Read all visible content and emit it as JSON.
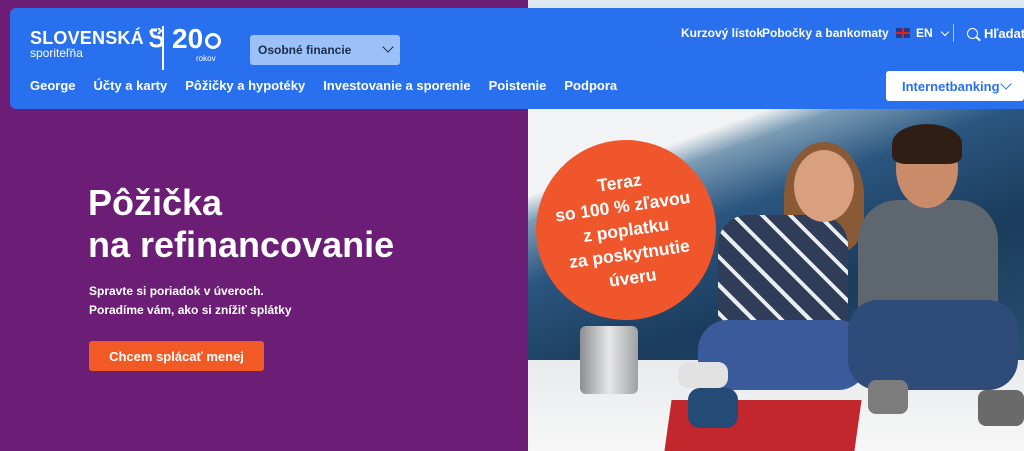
{
  "header": {
    "logo": {
      "main": "SLOVENSKÁ",
      "sub": "sporiteľňa"
    },
    "anniversary": {
      "number": "20",
      "sub": "rokov"
    },
    "segment": {
      "selected": "Osobné financie"
    },
    "utility": {
      "rate_list": "Kurzový lístok",
      "branches": "Pobočky a bankomaty",
      "language": "EN",
      "search": "Hľadať"
    },
    "nav": [
      "George",
      "Účty a karty",
      "Pôžičky a hypotéky",
      "Investovanie a sporenie",
      "Poistenie",
      "Podpora"
    ],
    "internetbanking": "Internetbanking"
  },
  "hero": {
    "title_line1": "Pôžička",
    "title_line2": "na refinancovanie",
    "subtitle_line1": "Spravte si poriadok v úveroch.",
    "subtitle_line2": "Poradíme vám, ako si znížiť splátky",
    "cta": "Chcem splácať menej"
  },
  "badge": {
    "lines": [
      "Teraz",
      "so 100 % zľavou",
      "z poplatku",
      "za poskytnutie",
      "úveru"
    ]
  },
  "colors": {
    "brand_blue": "#2870ed",
    "hero_purple": "#6c1e77",
    "accent_orange": "#f15a24"
  }
}
